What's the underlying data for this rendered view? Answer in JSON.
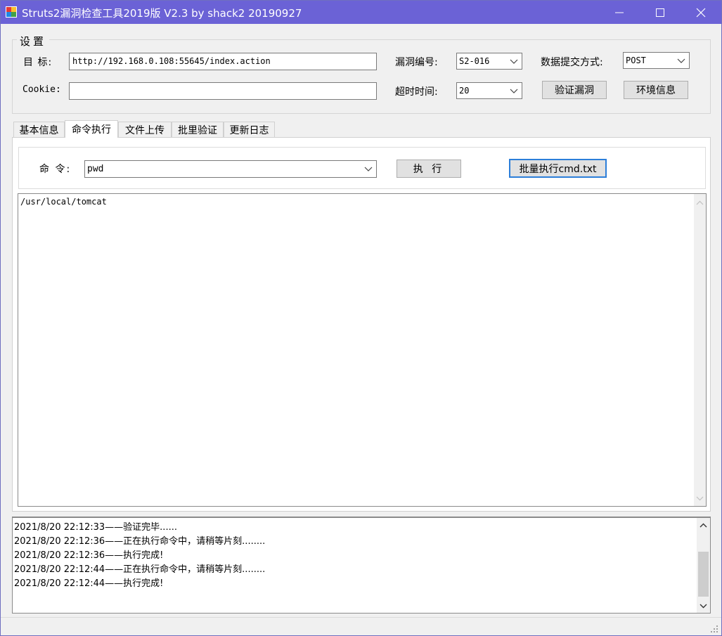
{
  "window": {
    "title": "Struts2漏洞检查工具2019版 V2.3 by shack2 20190927",
    "controls": {
      "minimize": "—",
      "maximize": "☐",
      "close": "✕"
    },
    "accent_color": "#6b62d6"
  },
  "settings": {
    "legend": "设置",
    "target_label": "目  标:",
    "target_value": "http://192.168.0.108:55645/index.action",
    "cookie_label": "Cookie:",
    "cookie_value": "",
    "vuln_label": "漏洞编号:",
    "vuln_value": "S2-016",
    "method_label": "数据提交方式:",
    "method_value": "POST",
    "timeout_label": "超时时间:",
    "timeout_value": "20",
    "verify_button": "验证漏洞",
    "env_button": "环境信息"
  },
  "tabs": [
    {
      "label": "基本信息"
    },
    {
      "label": "命令执行"
    },
    {
      "label": "文件上传"
    },
    {
      "label": "批里验证"
    },
    {
      "label": "更新日志"
    }
  ],
  "command": {
    "label": "命 令:",
    "value": "pwd",
    "execute_button": "执 行",
    "batch_button": "批量执行cmd.txt"
  },
  "output": {
    "text": "/usr/local/tomcat"
  },
  "log": {
    "lines": [
      "2021/8/20 22:12:33——验证完毕......",
      "2021/8/20 22:12:36——正在执行命令中，请稍等片刻........",
      "2021/8/20 22:12:36——执行完成!",
      "2021/8/20 22:12:44——正在执行命令中，请稍等片刻........",
      "2021/8/20 22:12:44——执行完成!"
    ]
  }
}
